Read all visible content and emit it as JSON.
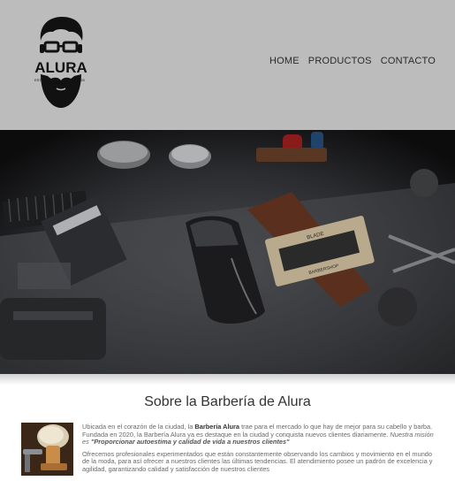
{
  "header": {
    "logo": {
      "brand": "ALURA",
      "year_left": "ESTD",
      "year_right": "2020"
    },
    "nav": [
      {
        "label": "HOME"
      },
      {
        "label": "PRODUCTOS"
      },
      {
        "label": "CONTACTO"
      }
    ]
  },
  "hero": {
    "card_line1": "BLADE",
    "card_line2": "BARBERSHOP"
  },
  "about": {
    "title": "Sobre la Barbería de Alura",
    "p1_a": "Ubicada en el corazón de la ciudad, la ",
    "p1_b": "Barbería Alura",
    "p1_c": " trae para el mercado lo que hay de mejor para su cabello y barba. Fundada en 2020, la Barbería Alura ya es destaque en la ciudad y conquista nuevos clientes diariamente. ",
    "p1_d": "Nuestra misión es ",
    "p1_e": "\"Proporcionar autoestima y calidad de vida a nuestros clientes\"",
    "p2": "Ofrecemos profesionales experimentados que están constantemente observando los cambios y movimiento en el mundo de la moda, para así ofrecer a nuestros clientes las últimas tendencias. El atendimiento posee un padrón de excelencia y agilidad, garantizando calidad y satisfacción de nuestros clientes"
  }
}
